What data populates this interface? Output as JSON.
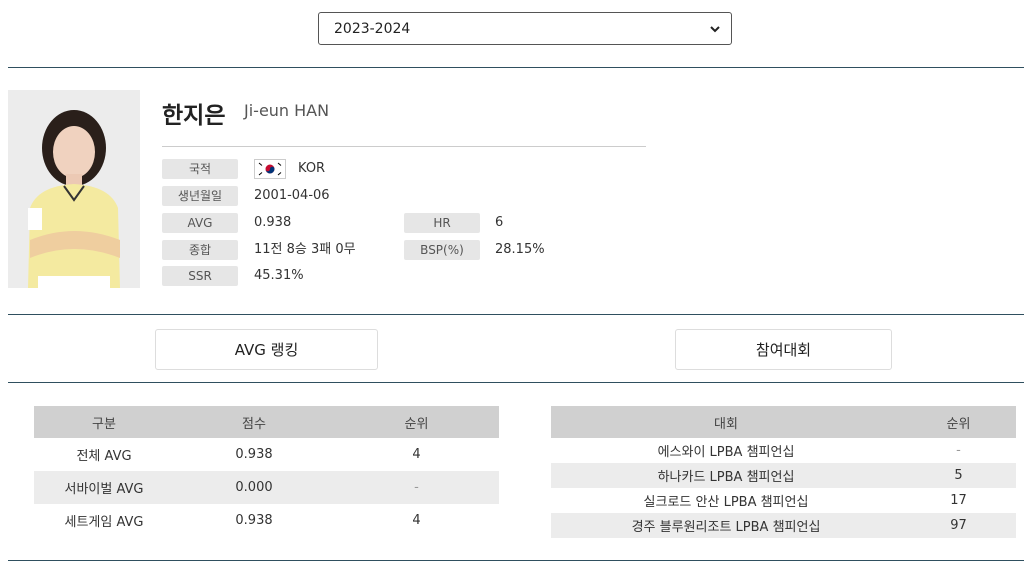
{
  "season_select": {
    "value": "2023-2024"
  },
  "player": {
    "name_ko": "한지은",
    "name_en": "Ji-eun HAN",
    "nationality": {
      "label": "국적",
      "value": "KOR",
      "flag_icon": "south-korea-flag-icon"
    },
    "birthdate": {
      "label": "생년월일",
      "value": "2001-04-06"
    },
    "avg": {
      "label": "AVG",
      "value": "0.938"
    },
    "hr": {
      "label": "HR",
      "value": "6"
    },
    "record": {
      "label": "종합",
      "value": "11전 8승 3패 0무"
    },
    "bsp": {
      "label": "BSP(%)",
      "value": "28.15%"
    },
    "ssr": {
      "label": "SSR",
      "value": "45.31%"
    }
  },
  "tabs": {
    "avg_ranking": "AVG 랭킹",
    "tournaments": "참여대회"
  },
  "avg_table": {
    "headers": [
      "구분",
      "점수",
      "순위"
    ],
    "rows": [
      [
        "전체 AVG",
        "0.938",
        "4"
      ],
      [
        "서바이벌 AVG",
        "0.000",
        "-"
      ],
      [
        "세트게임 AVG",
        "0.938",
        "4"
      ]
    ]
  },
  "tournament_table": {
    "headers": [
      "대회",
      "순위"
    ],
    "rows": [
      [
        "에스와이 LPBA 챔피언십",
        "-"
      ],
      [
        "하나카드 LPBA 챔피언십",
        "5"
      ],
      [
        "실크로드 안산 LPBA 챔피언십",
        "17"
      ],
      [
        "경주 블루원리조트 LPBA 챔피언십",
        "97"
      ]
    ]
  },
  "colors": {
    "rule": "#2f4f5f",
    "label_bg": "#e6e6e6",
    "table_header": "#d0d0d0",
    "row_alt": "#ececec"
  }
}
